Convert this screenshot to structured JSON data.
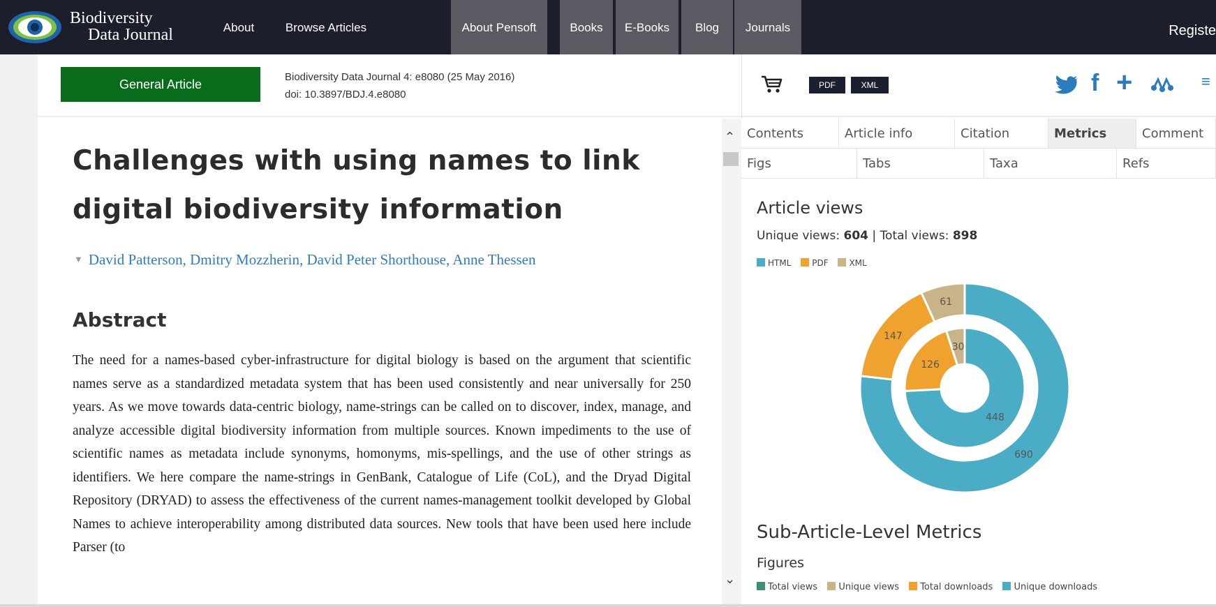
{
  "navbar": {
    "logo_line1": "Biodiversity",
    "logo_line2": "Data Journal",
    "items": [
      {
        "label": "About"
      },
      {
        "label": "Browse Articles"
      },
      {
        "label": "About Pensoft"
      },
      {
        "label": "Books"
      },
      {
        "label": "E-Books"
      },
      {
        "label": "Blog"
      },
      {
        "label": "Journals"
      }
    ],
    "register": "Registe"
  },
  "article": {
    "type_badge": "General Article",
    "journal_ref": "Biodiversity Data Journal 4: e8080 (25 May 2016)",
    "doi": "doi: 10.3897/BDJ.4.e8080",
    "title": "Challenges with using names to link digital biodiversity information",
    "authors": [
      "David Patterson",
      "Dmitry Mozzherin",
      "David Peter Shorthouse",
      "Anne Thessen"
    ],
    "abstract_heading": "Abstract",
    "abstract_text": "The need for a names-based cyber-infrastructure for digital biology is based on the argument that scientific names serve as a standardized metadata system that has been used consistently and near universally for 250 years. As we move towards data-centric biology, name-strings can be called on to discover, index, manage, and analyze accessible digital biodiversity information from multiple sources. Known impediments to the use of scientific names as metadata include synonyms, homonyms, mis-spellings, and the use of other strings as identifiers. We here compare the name-strings in GenBank, Catalogue of Life (CoL), and the Dryad Digital Repository (DRYAD) to assess the effectiveness of the current names-management toolkit developed by Global Names to achieve interoperability among distributed data sources. New tools that have been used here include Parser (to"
  },
  "toolbar": {
    "cart_icon": "cart-icon",
    "pdf_label": "PDF",
    "xml_label": "XML",
    "social_icons": [
      "twitter-icon",
      "facebook-icon",
      "plus-icon",
      "mendeley-icon"
    ]
  },
  "tabs": {
    "row1": [
      {
        "label": "Contents"
      },
      {
        "label": "Article info"
      },
      {
        "label": "Citation"
      },
      {
        "label": "Metrics",
        "active": true
      },
      {
        "label": "Comment"
      }
    ],
    "row2": [
      {
        "label": "Figs"
      },
      {
        "label": "Tabs"
      },
      {
        "label": "Taxa"
      },
      {
        "label": "Refs"
      }
    ]
  },
  "metrics": {
    "heading": "Article views",
    "unique_label": "Unique views:",
    "unique_value": "604",
    "total_label": "Total views:",
    "total_value": "898",
    "legend": [
      {
        "label": "HTML",
        "color": "#4bacc6"
      },
      {
        "label": "PDF",
        "color": "#f0a22e"
      },
      {
        "label": "XML",
        "color": "#c9b48a"
      }
    ],
    "sub_heading": "Sub-Article-Level Metrics",
    "figures_heading": "Figures",
    "figures_legend": [
      {
        "label": "Total views",
        "color": "#3f8f6e"
      },
      {
        "label": "Unique views",
        "color": "#c9b48a"
      },
      {
        "label": "Total downloads",
        "color": "#f0a22e"
      },
      {
        "label": "Unique downloads",
        "color": "#4bacc6"
      }
    ]
  },
  "chart_data": {
    "type": "pie",
    "variant": "double-donut",
    "categories": [
      "HTML",
      "PDF",
      "XML"
    ],
    "colors": [
      "#4bacc6",
      "#f0a22e",
      "#c9b48a"
    ],
    "series": [
      {
        "name": "Total views",
        "ring": "outer",
        "values": [
          690,
          147,
          61
        ]
      },
      {
        "name": "Unique views",
        "ring": "inner",
        "values": [
          448,
          126,
          30
        ]
      }
    ]
  }
}
